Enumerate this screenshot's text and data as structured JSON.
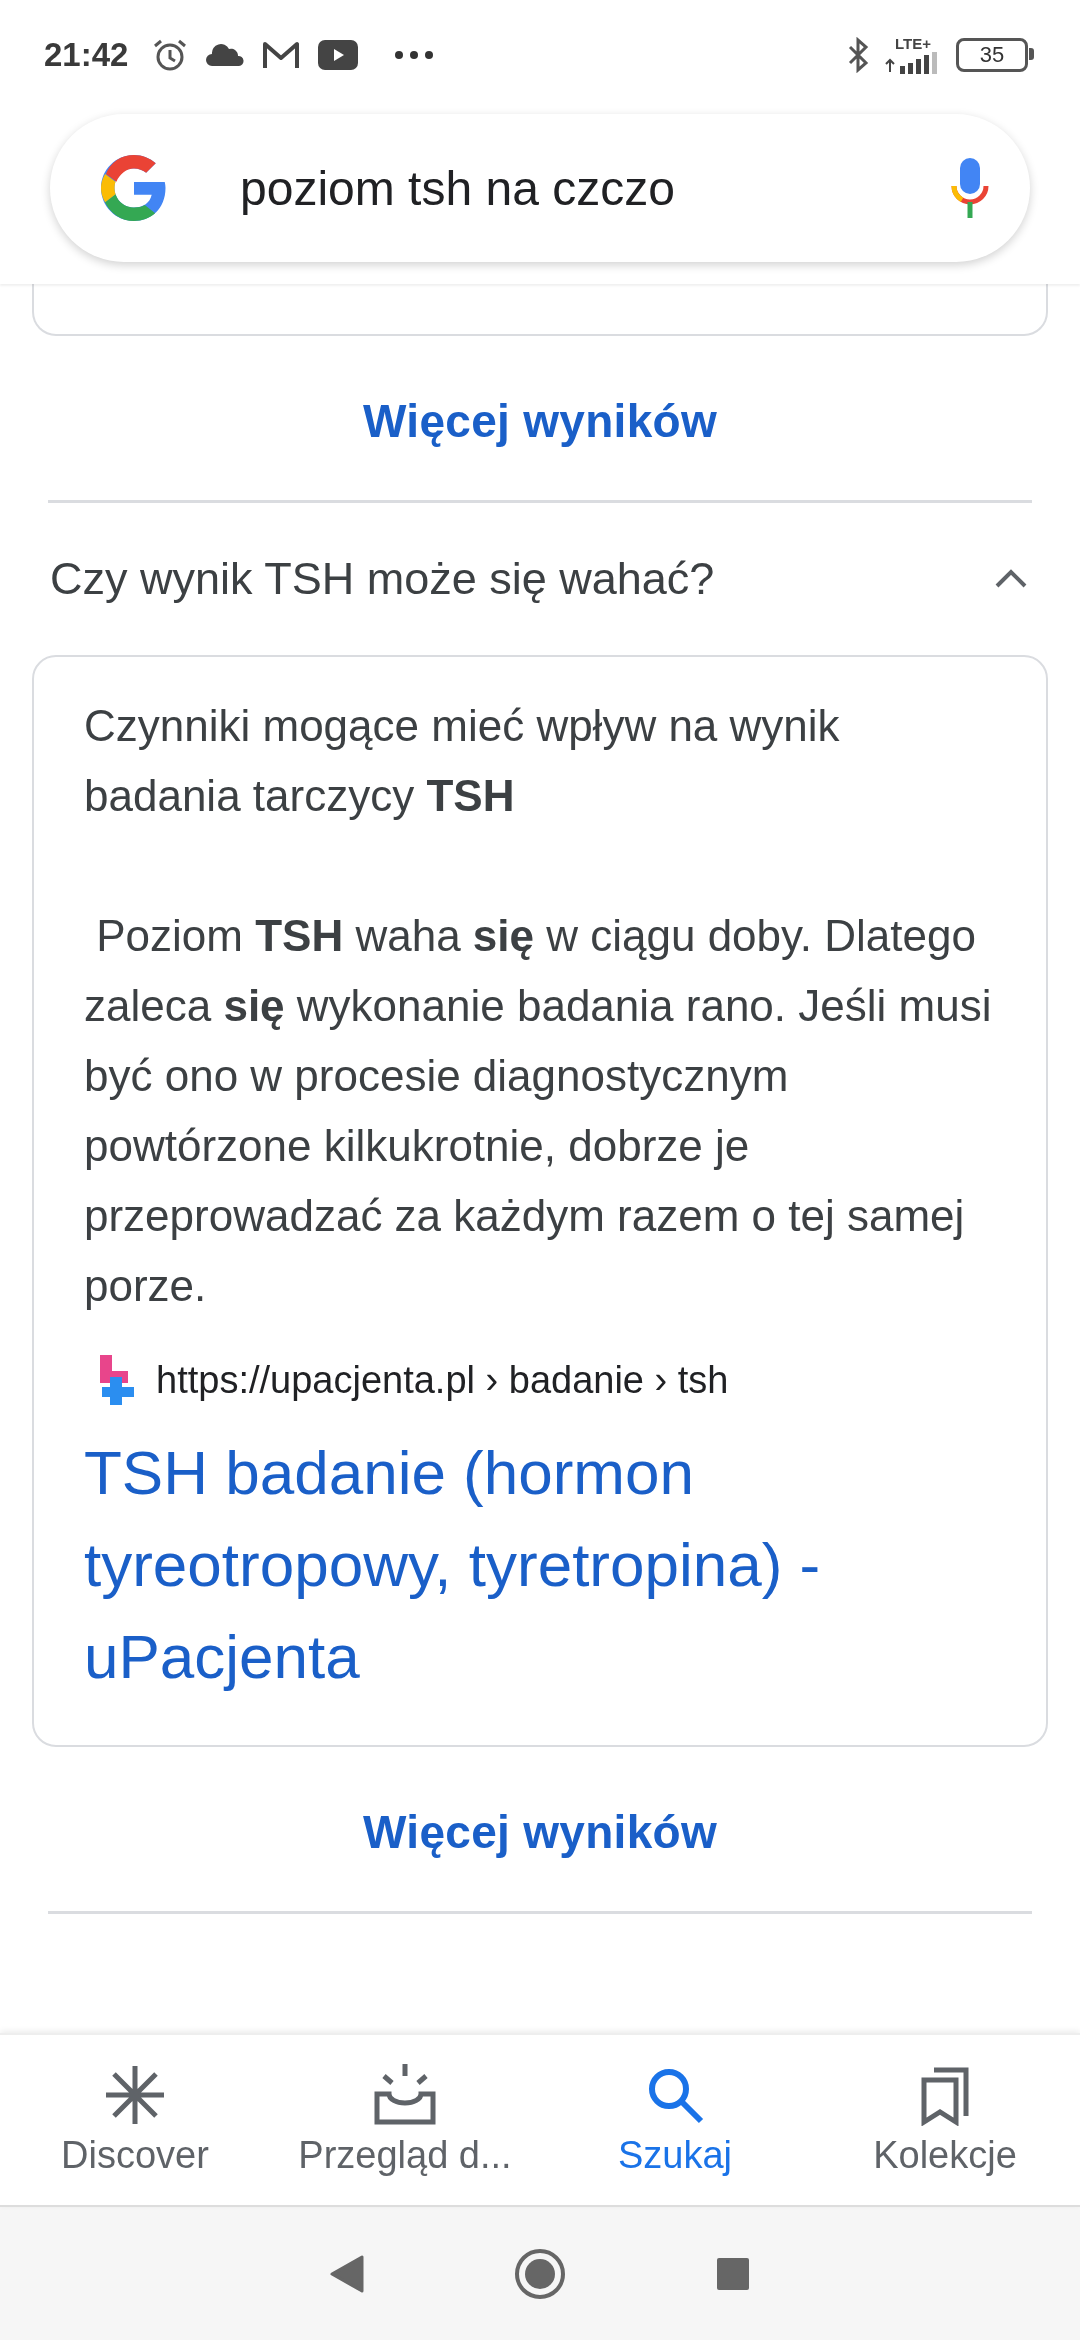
{
  "status_bar": {
    "time": "21:42",
    "network": "LTE+",
    "battery": "35"
  },
  "search": {
    "query": "poziom tsh na czczo"
  },
  "previous_section": {
    "more_results": "Więcej wyników"
  },
  "question": {
    "text": "Czy wynik TSH może się wahać?",
    "expanded": true,
    "answer": {
      "paragraphs": [
        "Czynniki mogące mieć wpływ na wynik badania tarczycy **TSH**",
        " Poziom **TSH** waha **się** w ciągu doby. Dlatego zaleca **się** wykonanie badania rano. Jeśli musi być ono w procesie diagnostycznym powtórzone kilkukrotnie, dobrze je przeprowadzać za każdym razem o tej samej porze."
      ],
      "source_url": "https://upacjenta.pl › badanie › tsh",
      "title": "TSH badanie (hormon tyreotropowy, tyretropina) - uPacjenta"
    },
    "more_results": "Więcej wyników"
  },
  "bottom_nav": [
    {
      "label": "Discover",
      "selected": false
    },
    {
      "label": "Przegląd d...",
      "selected": false
    },
    {
      "label": "Szukaj",
      "selected": true
    },
    {
      "label": "Kolekcje",
      "selected": false
    }
  ]
}
